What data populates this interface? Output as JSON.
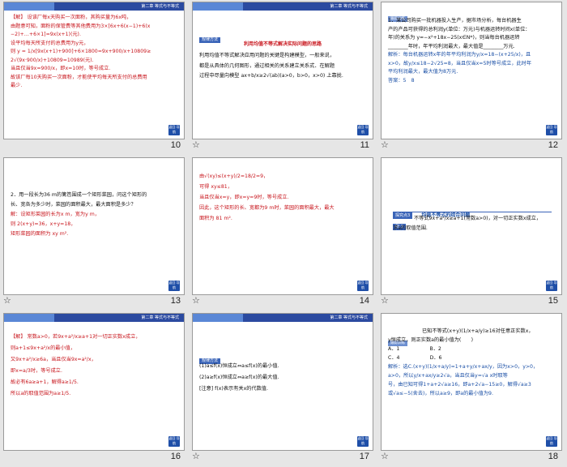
{
  "header_band_title": "第二章 等式与不等式",
  "back_button": "返回\n导航",
  "star_glyph": "☆",
  "slides": [
    {
      "number": "10",
      "lines": [
        "【解】 设该厂每x天购买一次面粉，其购买量为6x吨，",
        "由题意可知，面粉的保管费等其他费用为3×[6x+6(x−1)+6(x",
        "−2)+…+6×1]=9x(x+1)(元).",
        "设平均每天所支付的总费用为y元，",
        "则 y = 1/x[9x(x+1)+900]+6×1800=9x+900/x+10809≥",
        "2√(9x·900/x)+10809=10989(元).",
        "当且仅当9x=900/x，即x=10时，等号成立.",
        "故该厂每10天购买一次面粉，才能使平均每天所支付的总费用",
        "最少."
      ]
    },
    {
      "number": "11",
      "label": "规律方法",
      "subtitle": "利用均值不等式解决实际问题的思路",
      "lines": [
        "利用均值不等式解决应用问题的关键是构建模型，一般来说，",
        "都是从具体的几何图形，通过相关的关系建立关系式．在解题",
        "过程中尽量向模型 ax+b/x≥2√(ab)(a>0，b>0，x>0) 上靠拢."
      ]
    },
    {
      "number": "12",
      "label": "跟踪训练",
      "lines": [
        "1．某公司购买一批机器投入生产，据市场分析，每台机器生",
        "产的产品可获得的总利润y(单位：万元)与机器运转时间x(单位：",
        "年)的关系为 y=−x²+18x−25(x∈N*)，则当每台机器运转",
        "________年时，年平均利润最大，最大值是________万元.",
        "解析：每台机器运转x年的年平均利润为y/x=18−(x+25/x)，且",
        "x>0，故y/x≤18−2√25=8，当且仅当x=5时等号成立，此时年",
        "平均利润最大，最大值为8万元.",
        "答案：5　8"
      ]
    },
    {
      "number": "13",
      "lines": [
        "2．用一段长为36 m的篱笆围成一个矩形菜园，问这个矩形的",
        "长、宽各为多少时，菜园的面积最大，最大面积是多少？",
        "解：设矩形菜园的长为x m，宽为y m，",
        "则 2(x+y)=36，x+y=18，",
        "矩形菜园的面积为 xy m²."
      ]
    },
    {
      "number": "14",
      "lines": [
        "由√(xy)≤(x+y)/2=18/2=9，",
        "可得 xy≤81，",
        "当且仅当x=y，即x=y=9时，等号成立.",
        "因此，这个矩形的长、宽都为9 m时，菜园的面积最大，最大",
        "面积为 81 m²."
      ]
    },
    {
      "number": "15",
      "topic_tag": "探究点3",
      "topic_title": "均值不等式的综合问题",
      "example_tag": "例 3",
      "lines": [
        "不等式9x+a²/x≥a+1(常数a>0)，对一切正实数x成立，",
        "求a的取值范围."
      ]
    },
    {
      "number": "16",
      "lines": [
        "【解】 常数a>0，若9x+a²/x≥a+1对一切正实数x成立，",
        "则a+1≤9x+a²/x的最小值，",
        "又9x+a²/x≥6a，当且仅当9x=a²/x，",
        "即x=a/3时，等号成立.",
        "故必有6a≥a+1，解得a≥1/5.",
        "所以a的取值范围为a≥1/5."
      ]
    },
    {
      "number": "17",
      "label": "规律方法",
      "lines": [
        "(1)a≤f(x)恒成立⇔a≤f(x)的最小值.",
        "(2)a≥f(x)恒成立⇔a≥f(x)的最大值.",
        "[注意] f(x)表示有关x的代数值."
      ]
    },
    {
      "number": "18",
      "label": "跟踪训练",
      "lines": [
        "已知不等式(x+y)(1/x+a/y)≥16对任意正实数x，",
        "y恒成立，则正实数a的最小值为(　　)",
        "A．1　　　　　　B．2",
        "C．4　　　　　　D．6",
        "解析：选C.(x+y)(1/x+a/y)=1+a+y/x+ax/y，因为x>0，y>0，",
        "a>0，所以y/x+ax/y≥2√a，当且仅当y=√a x时取等",
        "号，由已知可得1+a+2√a≥16，即a+2√a−15≥0，解得√a≥3",
        "或√a≤−5(舍去)，所以a≥9，即a的最小值为9."
      ]
    }
  ]
}
